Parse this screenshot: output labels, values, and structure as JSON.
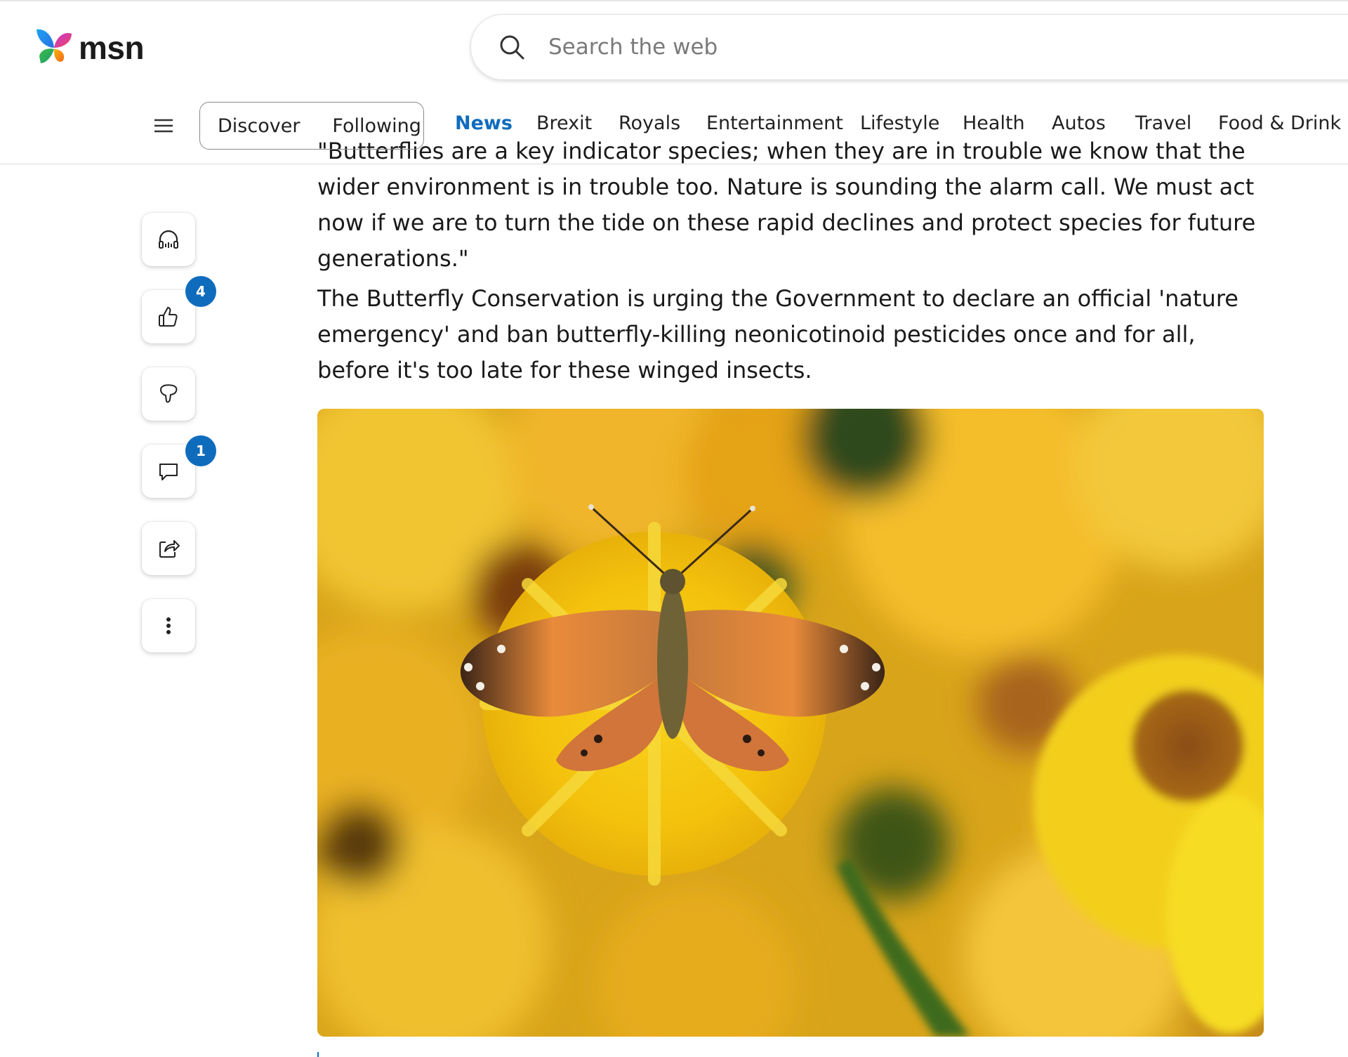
{
  "brand": {
    "name": "msn"
  },
  "search": {
    "placeholder": "Search the web"
  },
  "nav": {
    "feed_toggle": [
      "Discover",
      "Following"
    ],
    "items": [
      "News",
      "Brexit",
      "Royals",
      "Entertainment",
      "Lifestyle",
      "Health",
      "Autos",
      "Travel",
      "Food & Drink"
    ],
    "active": "News"
  },
  "article": {
    "paragraphs": [
      "\"Butterflies are a key indicator species; when they are in trouble we know that the wider environment is in trouble too. Nature is sounding the alarm call. We must act now if we are to turn the tide on these rapid declines and protect species for future generations.\"",
      "The Butterfly Conservation is urging the Government to declare an official 'nature emergency' and ban butterfly-killing neonicotinoid pesticides once and for all, before it's too late for these winged insects."
    ]
  },
  "actions": {
    "like_count": "4",
    "comment_count": "1",
    "icons": [
      "headphones-icon",
      "thumbs-up-icon",
      "thumbs-down-icon",
      "comment-icon",
      "share-icon",
      "more-options-icon"
    ]
  },
  "colors": {
    "accent": "#0f6cbd",
    "text": "#1a1a1a",
    "background": "#ffffff"
  }
}
